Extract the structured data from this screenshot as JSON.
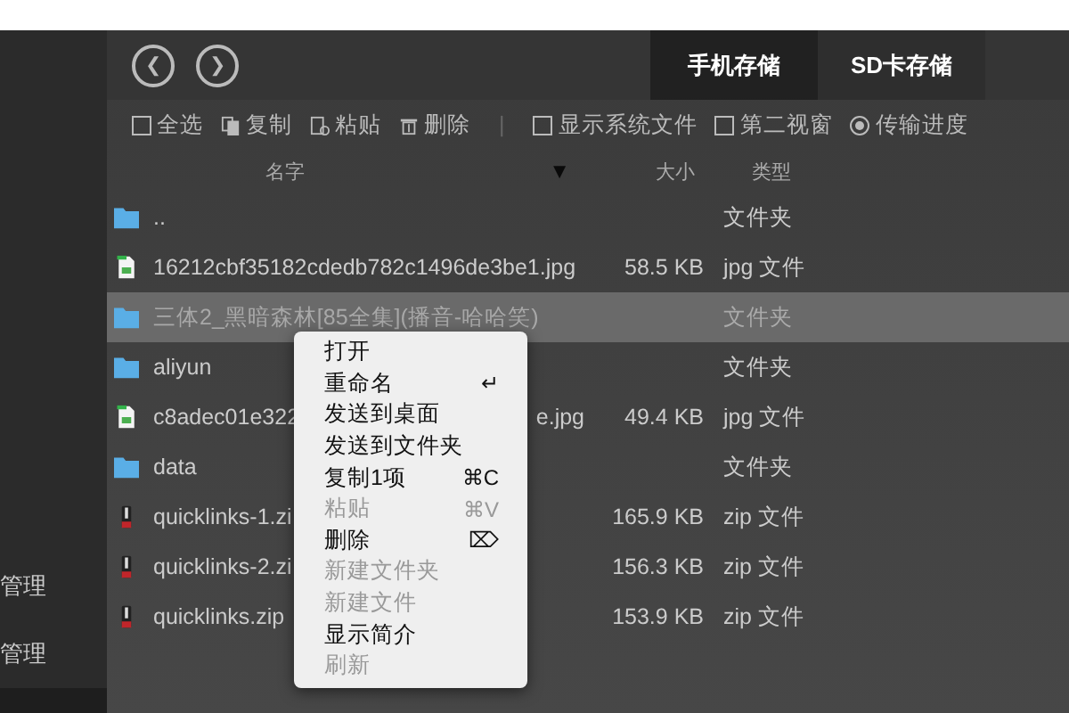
{
  "nav": {
    "back": "❮",
    "forward": "❯"
  },
  "tabs": [
    {
      "label": "手机存储",
      "selected": true
    },
    {
      "label": "SD卡存储",
      "selected": false
    }
  ],
  "toolbar": [
    {
      "kind": "checkbox",
      "label": "全选",
      "checked": false
    },
    {
      "kind": "copy",
      "label": "复制"
    },
    {
      "kind": "paste",
      "label": "粘贴"
    },
    {
      "kind": "delete",
      "label": "删除"
    },
    {
      "kind": "separator",
      "label": "|"
    },
    {
      "kind": "checkbox",
      "label": "显示系统文件",
      "checked": false
    },
    {
      "kind": "checkbox",
      "label": "第二视窗",
      "checked": false
    },
    {
      "kind": "radio",
      "label": "传输进度",
      "checked": true
    }
  ],
  "columns": {
    "name": "名字",
    "sort": "▼",
    "size": "大小",
    "type": "类型"
  },
  "rows": [
    {
      "kind": "folder",
      "name": "..",
      "type": "文件夹",
      "selected": false
    },
    {
      "kind": "image",
      "name": "16212cbf35182cdedb782c1496de3be1.jpg",
      "size": "58.5 KB",
      "type": "jpg 文件",
      "selected": false
    },
    {
      "kind": "folder",
      "name": "三体2_黑暗森林[85全集](播音-哈哈笑)",
      "type": "文件夹",
      "selected": true
    },
    {
      "kind": "folder",
      "name": "aliyun",
      "type": "文件夹",
      "selected": false
    },
    {
      "kind": "image",
      "name": "c8adec01e322",
      "name_end": "e.jpg",
      "size": "49.4 KB",
      "type": "jpg 文件",
      "selected": false
    },
    {
      "kind": "folder",
      "name": "data",
      "type": "文件夹",
      "selected": false
    },
    {
      "kind": "zip",
      "name": "quicklinks-1.zi",
      "size": "165.9 KB",
      "type": "zip 文件",
      "selected": false
    },
    {
      "kind": "zip",
      "name": "quicklinks-2.zi",
      "size": "156.3 KB",
      "type": "zip 文件",
      "selected": false
    },
    {
      "kind": "zip",
      "name": "quicklinks.zip",
      "size": "153.9 KB",
      "type": "zip 文件",
      "selected": false
    }
  ],
  "sidebar": {
    "items": [
      {
        "label": "管理"
      },
      {
        "label": "管理"
      }
    ]
  },
  "context_menu": [
    {
      "label": "打开",
      "disabled": false
    },
    {
      "label": "重命名",
      "shortcut": "↵",
      "disabled": false
    },
    {
      "label": "发送到桌面",
      "disabled": false
    },
    {
      "label": "发送到文件夹",
      "disabled": false
    },
    {
      "label": "复制1项",
      "shortcut": "⌘C",
      "disabled": false
    },
    {
      "label": "粘贴",
      "shortcut": "⌘V",
      "disabled": true
    },
    {
      "label": "删除",
      "shortcut": "⌦",
      "disabled": false
    },
    {
      "label": "新建文件夹",
      "disabled": true
    },
    {
      "label": "新建文件",
      "disabled": true
    },
    {
      "label": "显示简介",
      "disabled": false
    },
    {
      "label": "刷新",
      "disabled": true
    }
  ]
}
